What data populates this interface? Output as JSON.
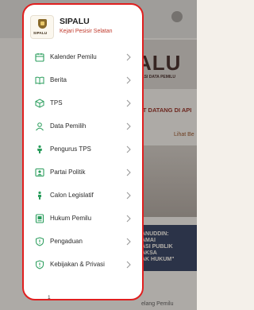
{
  "background": {
    "banner_big": "ALU",
    "banner_small": "ASI DATA PEMILU",
    "marquee": "AT DATANG DI API",
    "more_link": "Lihat Be",
    "poster_text": "ANUDDIN:\nAMAI\nASI PUBLIK\nAKSA\nAK HUKUM\"",
    "footer_text": "elang Pemilu"
  },
  "drawer": {
    "app_name": "SIPALU",
    "app_subtitle": "Kejari Pesisir Selatan",
    "logo_word": "SIPALU",
    "items": [
      {
        "label": "Kalender Pemilu",
        "icon": "calendar-icon"
      },
      {
        "label": "Berita",
        "icon": "book-icon"
      },
      {
        "label": "TPS",
        "icon": "box-icon"
      },
      {
        "label": "Data Pemilih",
        "icon": "person-icon"
      },
      {
        "label": "Pengurus TPS",
        "icon": "officer-icon"
      },
      {
        "label": "Partai Politik",
        "icon": "party-icon"
      },
      {
        "label": "Calon Legislatif",
        "icon": "candidate-icon"
      },
      {
        "label": "Hukum Pemilu",
        "icon": "law-icon"
      },
      {
        "label": "Pengaduan",
        "icon": "complaint-icon"
      },
      {
        "label": "Kebijakan & Privasi",
        "icon": "shield-icon"
      }
    ],
    "version": "1"
  },
  "colors": {
    "accent": "#2a9d5c",
    "border": "#e01f1f",
    "subtitle": "#c0392b"
  }
}
